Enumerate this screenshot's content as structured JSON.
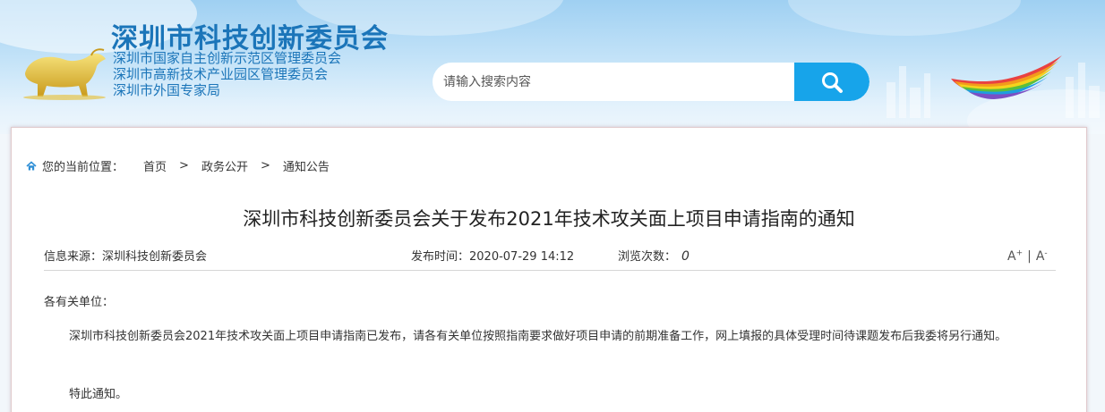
{
  "header": {
    "title": "深圳市科技创新委员会",
    "subtitles": [
      "深圳市国家自主创新示范区管理委员会",
      "深圳市高新技术产业园区管理委员会",
      "深圳市外国专家局"
    ]
  },
  "search": {
    "placeholder": "请输入搜索内容",
    "button_icon": "search-icon",
    "accent_color": "#17a4ea"
  },
  "breadcrumb": {
    "label": "您的当前位置：",
    "items": [
      "首页",
      "政务公开",
      "通知公告"
    ],
    "separator": ">"
  },
  "article": {
    "title": "深圳市科技创新委员会关于发布2021年技术攻关面上项目申请指南的通知",
    "source_label": "信息来源：",
    "source": "深圳科技创新委员会",
    "date_label": "发布时间：",
    "date": "2020-07-29 14:12",
    "views_label": "浏览次数：",
    "views": "0",
    "font_increase": "A",
    "font_increase_mark": "+",
    "font_sep": "|",
    "font_decrease": "A",
    "font_decrease_mark": "-",
    "salutation": "各有关单位：",
    "body": "深圳市科技创新委员会2021年技术攻关面上项目申请指南已发布，请各有关单位按照指南要求做好项目申请的前期准备工作，网上填报的具体受理时间待课题发布后我委将另行通知。",
    "closing": "特此通知。"
  }
}
